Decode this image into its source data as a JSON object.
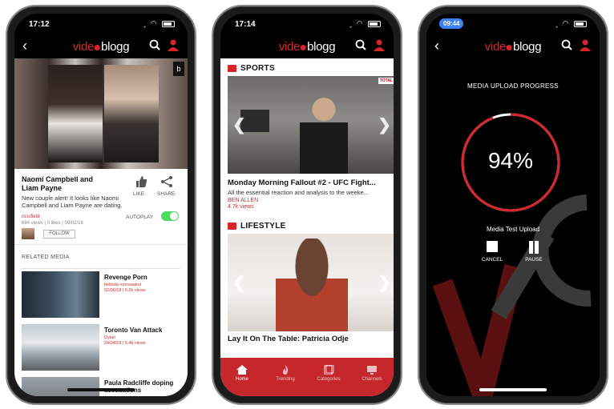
{
  "brand": {
    "logo_v": "vide",
    "logo_b": "blogg",
    "accent": "#d9242a"
  },
  "phone1": {
    "time": "17:12",
    "video": {
      "title": "Naomi Campbell and Liam Payne",
      "description": "New couple alert! It looks like Naomi Campbell and Liam Payne are dating.",
      "author": "rossfield",
      "meta": "684 views | 0 likes | 09/02/18",
      "like_label": "LIKE",
      "share_label": "SHARE",
      "autoplay_label": "AUTOPLAY",
      "autoplay_on": true,
      "follow_label": "FOLLOW",
      "badge": "b"
    },
    "related_header": "RELATED MEDIA",
    "related": [
      {
        "title": "Revenge Porn",
        "author": "belinda nomsaakul",
        "meta": "02/06/18 | 6.2k views"
      },
      {
        "title": "Toronto Van Attack",
        "author": "Dylan",
        "meta": "24/04/18 | 5.4k views"
      },
      {
        "title": "Paula Radcliffe doping accusations",
        "author": "",
        "meta": ""
      }
    ]
  },
  "phone2": {
    "time": "17:14",
    "sections": [
      {
        "name": "SPORTS",
        "title": "Monday Morning Fallout #2 - UFC Fight...",
        "subtitle": "All the essential reaction and analysis to the weeke...",
        "author": "BEN ALLEN",
        "views": "4.7k views",
        "corner_logo": "TOTAL"
      },
      {
        "name": "LIFESTYLE",
        "title": "Lay It On The Table: Patricia Odje"
      }
    ],
    "tabs": [
      {
        "label": "Home",
        "icon": "home-icon",
        "active": true
      },
      {
        "label": "Trending",
        "icon": "flame-icon",
        "active": false
      },
      {
        "label": "Categories",
        "icon": "categories-icon",
        "active": false
      },
      {
        "label": "Channels",
        "icon": "channels-icon",
        "active": false
      }
    ]
  },
  "phone3": {
    "time": "09:44",
    "upload_title": "MEDIA UPLOAD PROGRESS",
    "progress_percent": 94,
    "percent_label": "94%",
    "media_name": "Media Test Upload",
    "cancel_label": "CANCEL",
    "pause_label": "PAUSE"
  }
}
